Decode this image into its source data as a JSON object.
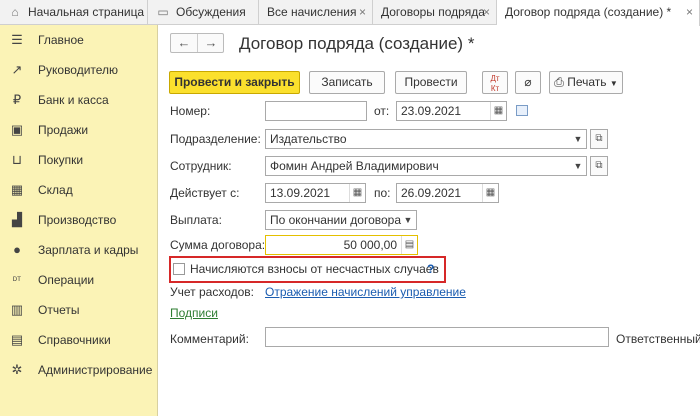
{
  "tabs": {
    "home": "Начальная страница",
    "discussions": "Обсуждения",
    "all_accruals": "Все начисления",
    "contracts": "Договоры подряда",
    "contract_new": "Договор подряда (создание) *",
    "close_glyph": "×"
  },
  "sidebar": {
    "items": [
      {
        "label": "Главное",
        "icon": "menu-icon",
        "glyph": "☰"
      },
      {
        "label": "Руководителю",
        "icon": "trend-icon",
        "glyph": "↗"
      },
      {
        "label": "Банк и касса",
        "icon": "coin-icon",
        "glyph": "₽"
      },
      {
        "label": "Продажи",
        "icon": "bag-icon",
        "glyph": "▣"
      },
      {
        "label": "Покупки",
        "icon": "cart-icon",
        "glyph": "⊔"
      },
      {
        "label": "Склад",
        "icon": "warehouse-icon",
        "glyph": "▦"
      },
      {
        "label": "Производство",
        "icon": "factory-icon",
        "glyph": "▟"
      },
      {
        "label": "Зарплата и кадры",
        "icon": "person-icon",
        "glyph": "●"
      },
      {
        "label": "Операции",
        "icon": "dt-kt-icon",
        "glyph": "ᴰᵀ"
      },
      {
        "label": "Отчеты",
        "icon": "bar-chart-icon",
        "glyph": "▥"
      },
      {
        "label": "Справочники",
        "icon": "books-icon",
        "glyph": "▤"
      },
      {
        "label": "Администрирование",
        "icon": "gear-icon",
        "glyph": "✲"
      }
    ]
  },
  "nav": {
    "back": "←",
    "forward": "→"
  },
  "form": {
    "title": "Договор подряда (создание) *",
    "toolbar": {
      "post_close": "Провести и закрыть",
      "save": "Записать",
      "post": "Провести",
      "print": "Печать"
    },
    "number_label": "Номер:",
    "number_value": "",
    "from_label": "от:",
    "date_value": "23.09.2021",
    "division_label": "Подразделение:",
    "division_value": "Издательство",
    "employee_label": "Сотрудник:",
    "employee_value": "Фомин Андрей Владимирович",
    "valid_from_label": "Действует с:",
    "valid_from_value": "13.09.2021",
    "valid_to_label": "по:",
    "valid_to_value": "26.09.2021",
    "payment_label": "Выплата:",
    "payment_value": "По окончании договора",
    "amount_label": "Сумма договора:",
    "amount_value": "50 000,00",
    "insurance_checkbox": "Начисляются взносы от несчастных случаев",
    "help": "?",
    "expense_label": "Учет расходов:",
    "expense_link": "Отражение начислений управление",
    "signatures_link": "Подписи",
    "comment_label": "Комментарий:",
    "comment_value": "",
    "responsible_label": "Ответственный:"
  }
}
